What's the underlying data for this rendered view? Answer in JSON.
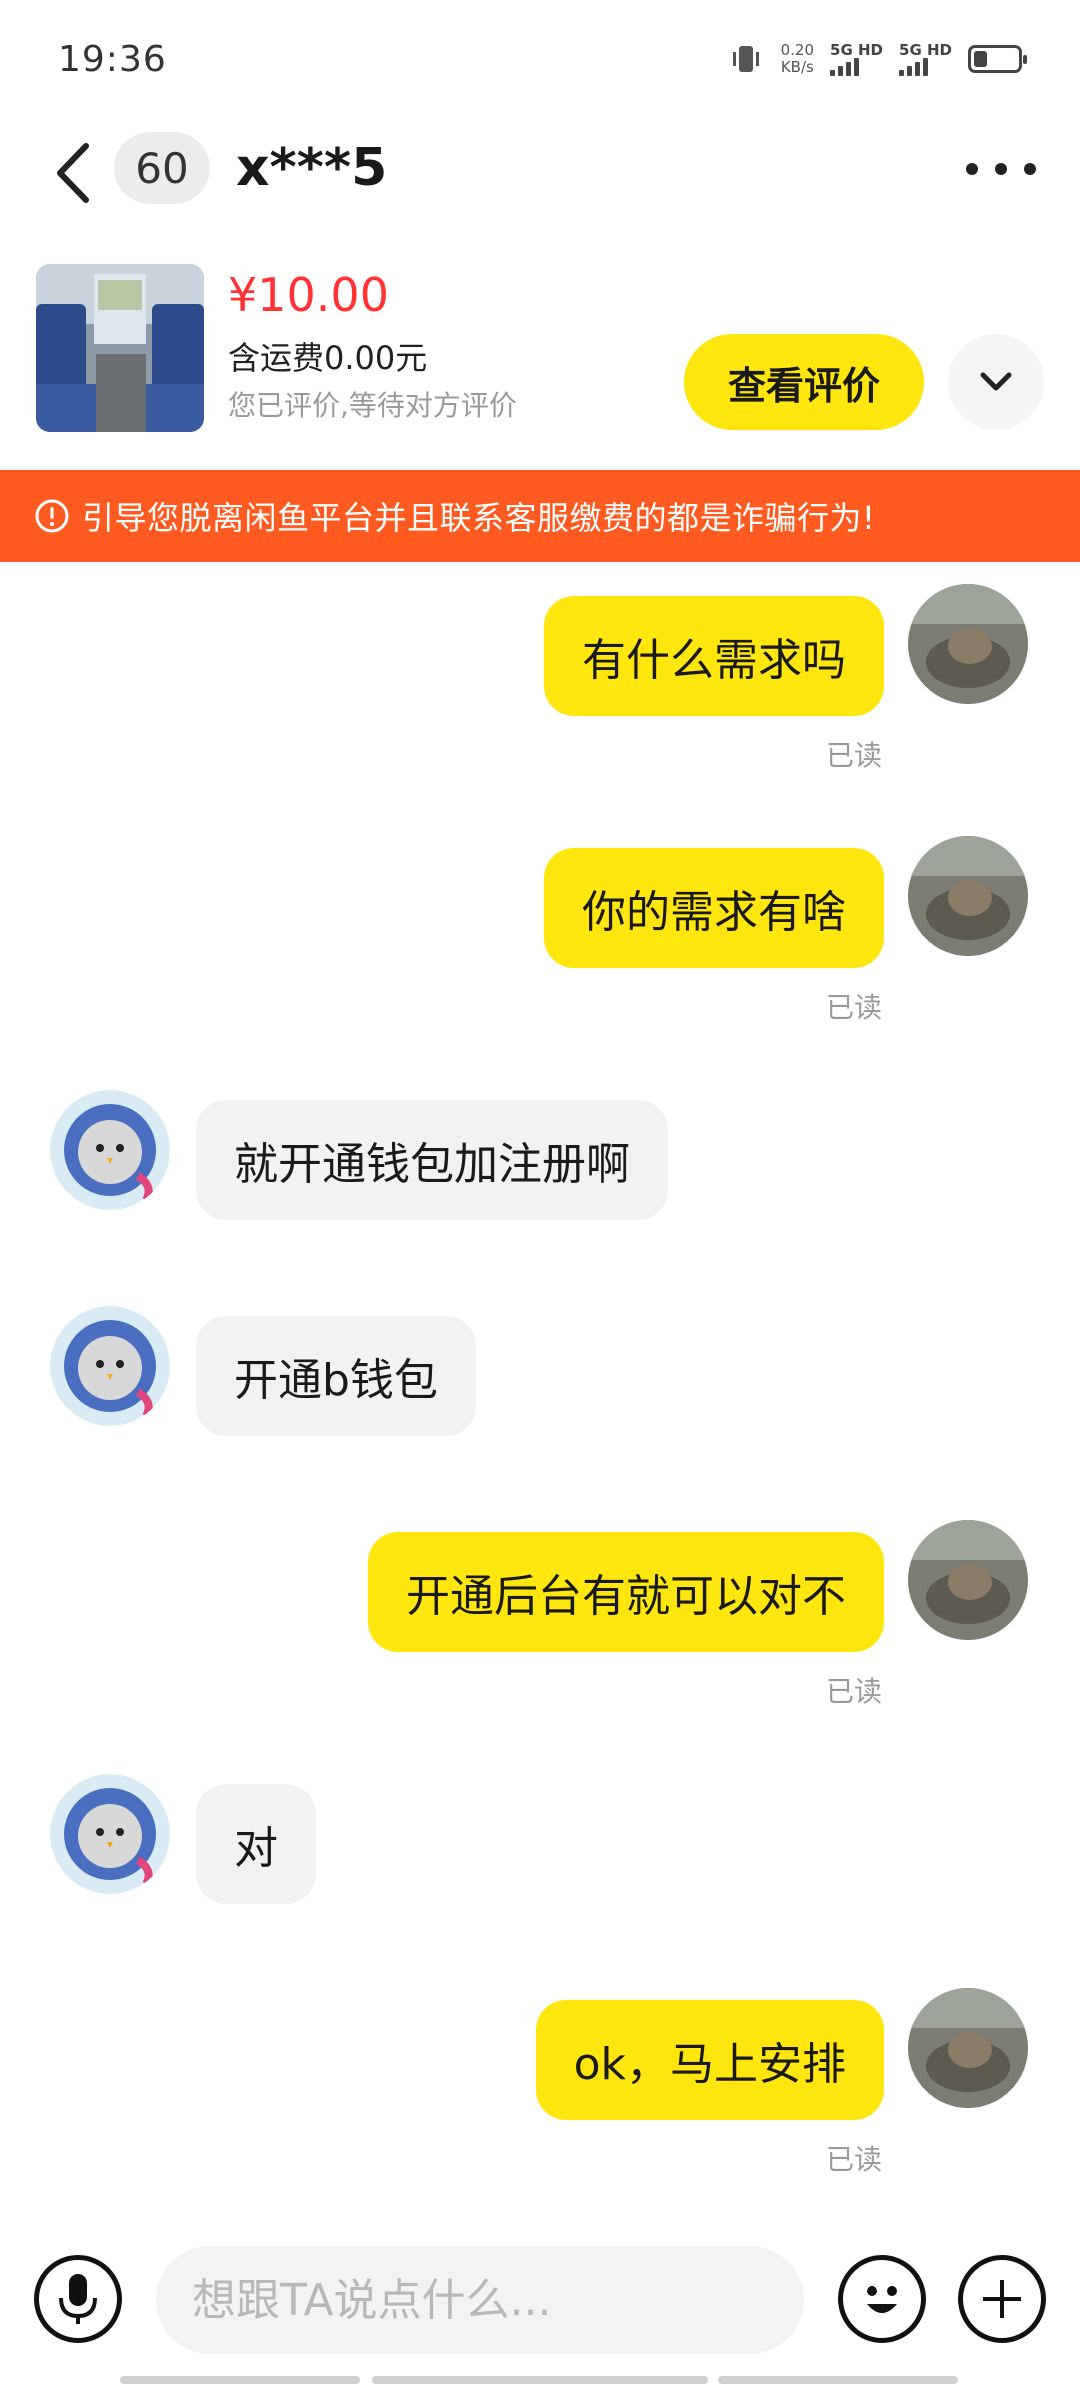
{
  "status_bar": {
    "time": "19:36",
    "net_speed_value": "0.20",
    "net_speed_unit": "KB/s",
    "signal1_label": "5G HD",
    "signal2_label": "5G HD",
    "battery_level": 0.3
  },
  "header": {
    "unread_count": "60",
    "contact_name": "x***5",
    "more_icon": "more-dots-icon",
    "back_icon": "chevron-left-icon"
  },
  "product": {
    "price": "¥10.00",
    "shipping": "含运费0.00元",
    "status": "您已评价,等待对方评价",
    "review_button": "查看评价",
    "expand_icon": "chevron-down-icon"
  },
  "warning": {
    "text": "引导您脱离闲鱼平台并且联系客服缴费的都是诈骗行为!"
  },
  "messages": [
    {
      "sender": "me",
      "text": "有什么需求吗",
      "status": "已读"
    },
    {
      "sender": "me",
      "text": "你的需求有啥",
      "status": "已读"
    },
    {
      "sender": "them",
      "text": "就开通钱包加注册啊"
    },
    {
      "sender": "them",
      "text": "开通b钱包"
    },
    {
      "sender": "me",
      "text": "开通后台有就可以对不",
      "status": "已读"
    },
    {
      "sender": "them",
      "text": "对"
    },
    {
      "sender": "me",
      "text": "ok，马上安排",
      "status": "已读"
    }
  ],
  "input": {
    "placeholder": "想跟TA说点什么...",
    "mic_icon": "microphone-icon",
    "emoji_icon": "emoji-icon",
    "plus_icon": "plus-icon"
  },
  "colors": {
    "accent_yellow": "#ffe60f",
    "warning_orange": "#ff5a1f",
    "price_red": "#ff3333"
  }
}
